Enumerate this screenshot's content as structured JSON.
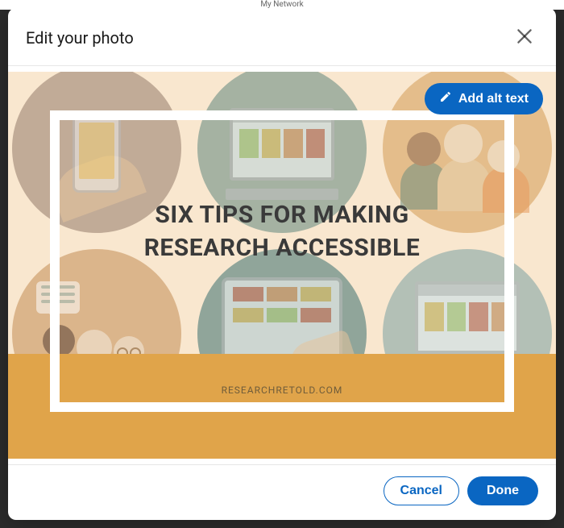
{
  "header": {
    "title": "Edit your photo"
  },
  "nav_hint": "My Network",
  "alt_text_button": "Add alt text",
  "image": {
    "title_line1": "SIX TIPS FOR MAKING",
    "title_line2": "RESEARCH ACCESSIBLE",
    "footer": "RESEARCHRETOLD.COM"
  },
  "footer": {
    "cancel": "Cancel",
    "done": "Done"
  },
  "colors": {
    "accent": "#0a66c2",
    "canvas_bg": "#f9e7cf",
    "band": "#e0a44a"
  }
}
